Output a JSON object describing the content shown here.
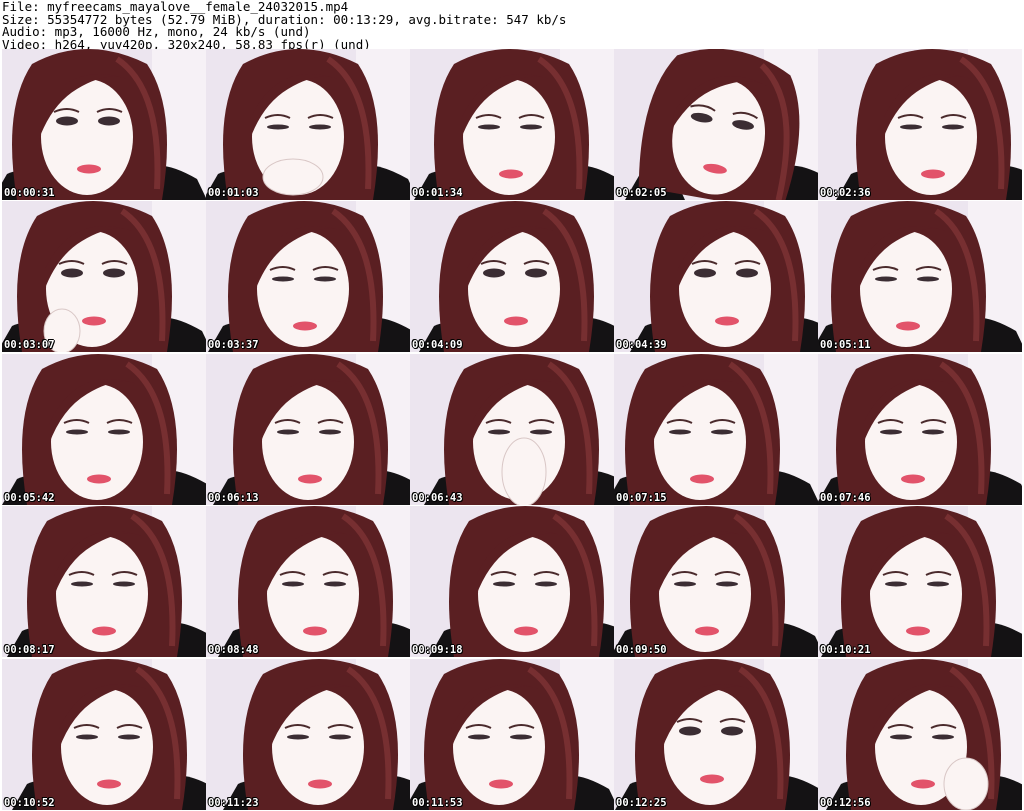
{
  "header": {
    "lines": [
      "File: myfreecams_mayalove__female_24032015.mp4",
      "Size: 55354772 bytes (52.79 MiB), duration: 00:13:29, avg.bitrate: 547 kb/s",
      "Audio: mp3, 16000 Hz, mono, 24 kb/s (und)",
      "Video: h264, yuv420p, 320x240, 58.83 fps(r) (und)"
    ]
  },
  "grid": {
    "columns": 5,
    "rows": 5
  },
  "colors": {
    "background": "#ffffff",
    "hair": "#5a1f22",
    "hair_highlight": "#8a3a3c",
    "skin": "#fbf4f3",
    "backdrop": "#ece5ef",
    "clothing": "#141214",
    "lips": "#e2536a"
  },
  "thumbnails": [
    {
      "timestamp": "00:00:31",
      "pose": "front"
    },
    {
      "timestamp": "00:01:03",
      "pose": "hand-chin"
    },
    {
      "timestamp": "00:01:34",
      "pose": "down"
    },
    {
      "timestamp": "00:02:05",
      "pose": "tilt"
    },
    {
      "timestamp": "00:02:36",
      "pose": "down"
    },
    {
      "timestamp": "00:03:07",
      "pose": "hand-mouth"
    },
    {
      "timestamp": "00:03:37",
      "pose": "down"
    },
    {
      "timestamp": "00:04:09",
      "pose": "front"
    },
    {
      "timestamp": "00:04:39",
      "pose": "front"
    },
    {
      "timestamp": "00:05:11",
      "pose": "down"
    },
    {
      "timestamp": "00:05:42",
      "pose": "down"
    },
    {
      "timestamp": "00:06:13",
      "pose": "down"
    },
    {
      "timestamp": "00:06:43",
      "pose": "hand-nose"
    },
    {
      "timestamp": "00:07:15",
      "pose": "down"
    },
    {
      "timestamp": "00:07:46",
      "pose": "down"
    },
    {
      "timestamp": "00:08:17",
      "pose": "down"
    },
    {
      "timestamp": "00:08:48",
      "pose": "down"
    },
    {
      "timestamp": "00:09:18",
      "pose": "down"
    },
    {
      "timestamp": "00:09:50",
      "pose": "down"
    },
    {
      "timestamp": "00:10:21",
      "pose": "down"
    },
    {
      "timestamp": "00:10:52",
      "pose": "down"
    },
    {
      "timestamp": "00:11:23",
      "pose": "down"
    },
    {
      "timestamp": "00:11:53",
      "pose": "down"
    },
    {
      "timestamp": "00:12:25",
      "pose": "front"
    },
    {
      "timestamp": "00:12:56",
      "pose": "hand-cheek"
    }
  ]
}
